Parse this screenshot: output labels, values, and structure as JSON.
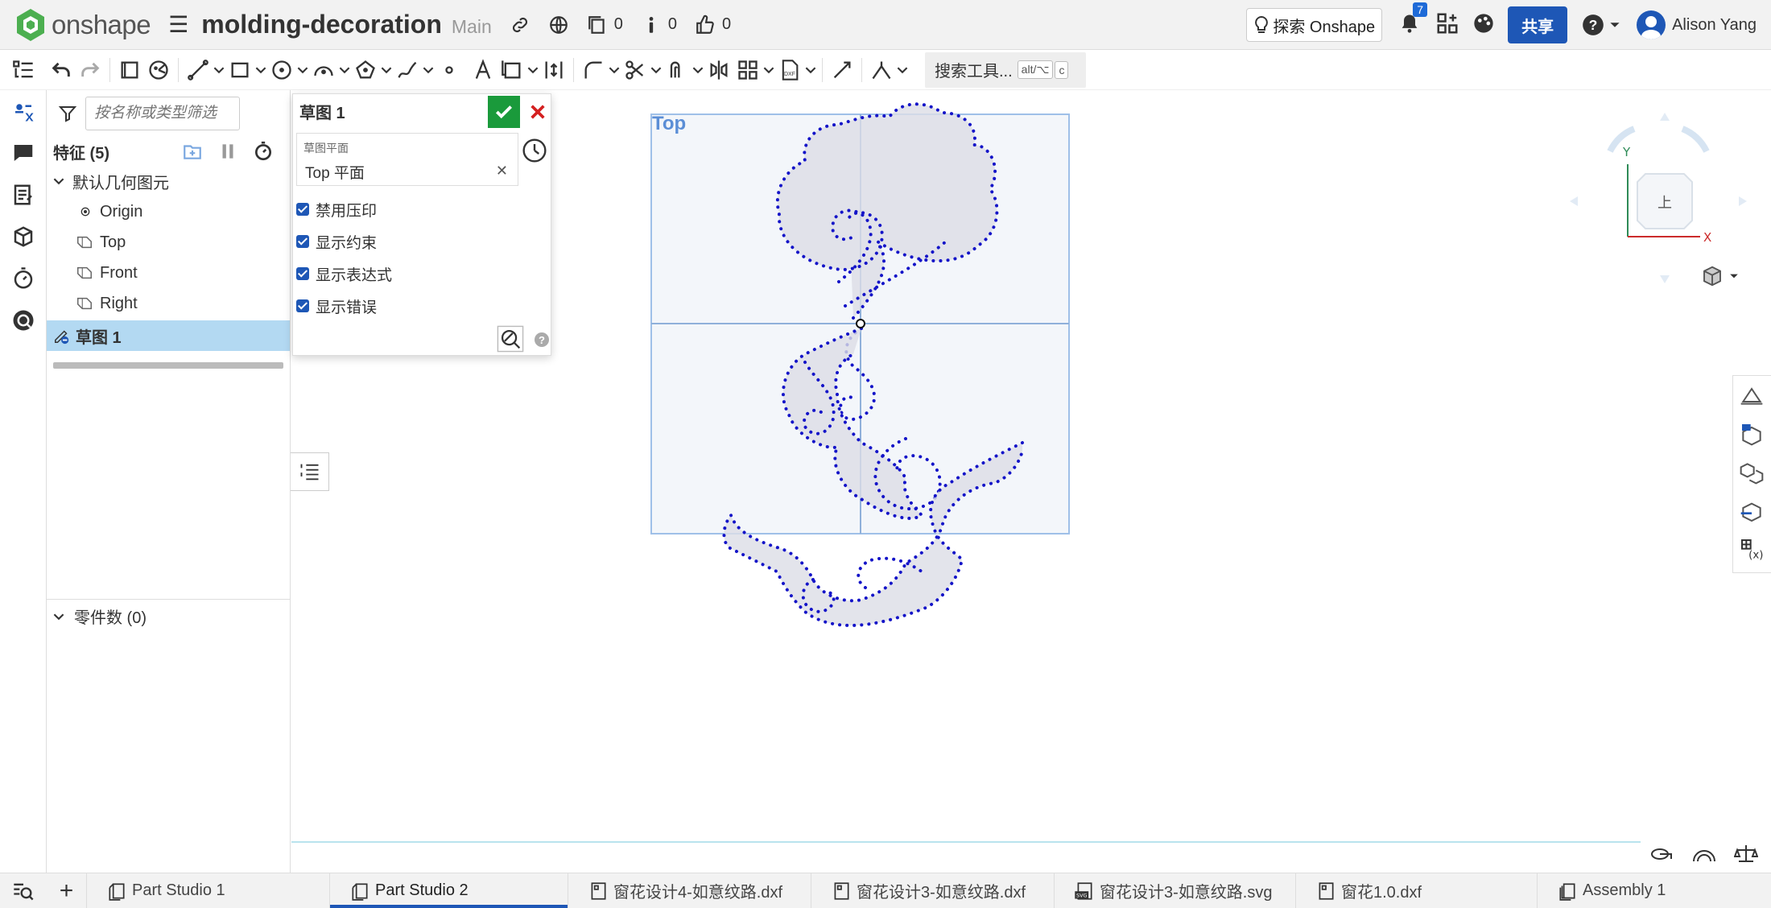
{
  "header": {
    "logo_text": "onshape",
    "doc_title": "molding-decoration",
    "branch": "Main",
    "versions_count": "0",
    "comments_count": "0",
    "likes_count": "0",
    "explore_label": "探索 Onshape",
    "notification_count": "7",
    "share_label": "共享",
    "user_name": "Alison Yang"
  },
  "toolbar": {
    "search_label": "搜索工具...",
    "shortcut_mod": "alt/⌥",
    "shortcut_key": "c"
  },
  "feature_panel": {
    "filter_placeholder": "按名称或类型筛选",
    "features_header": "特征 (5)",
    "default_geometry": "默认几何图元",
    "items": [
      {
        "label": "Origin"
      },
      {
        "label": "Top"
      },
      {
        "label": "Front"
      },
      {
        "label": "Right"
      }
    ],
    "sketch_item": "草图 1",
    "parts_header": "零件数 (0)"
  },
  "sketch_dialog": {
    "title": "草图 1",
    "plane_label": "草图平面",
    "plane_value": "Top 平面",
    "checkboxes": [
      {
        "label": "禁用压印",
        "checked": true
      },
      {
        "label": "显示约束",
        "checked": true
      },
      {
        "label": "显示表达式",
        "checked": true
      },
      {
        "label": "显示错误",
        "checked": true
      }
    ]
  },
  "viewport": {
    "plane_label": "Top",
    "view_cube_face": "上",
    "axis_x": "X",
    "axis_y": "Y",
    "sketch_color": "#1414c8"
  },
  "tabs": [
    {
      "label": "Part Studio 1",
      "icon": "part-studio-icon",
      "active": false
    },
    {
      "label": "Part Studio 2",
      "icon": "part-studio-icon",
      "active": true
    },
    {
      "label": "窗花设计4-如意纹路.dxf",
      "icon": "file-icon",
      "active": false
    },
    {
      "label": "窗花设计3-如意纹路.dxf",
      "icon": "file-icon",
      "active": false
    },
    {
      "label": "窗花设计3-如意纹路.svg",
      "icon": "svg-file-icon",
      "active": false
    },
    {
      "label": "窗花1.0.dxf",
      "icon": "file-icon",
      "active": false
    },
    {
      "label": "Assembly 1",
      "icon": "assembly-icon",
      "active": false
    }
  ],
  "colors": {
    "brand_blue": "#1e57b6",
    "ok_green": "#1a9a3b",
    "selection_blue": "#b3d9f2"
  }
}
